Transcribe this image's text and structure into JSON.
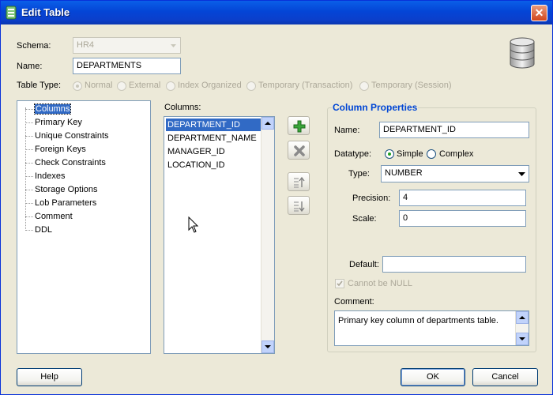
{
  "window": {
    "title": "Edit Table"
  },
  "schema": {
    "label": "Schema:",
    "value": "HR4"
  },
  "name": {
    "label": "Name:",
    "value": "DEPARTMENTS"
  },
  "table_type": {
    "label": "Table Type:",
    "options": [
      "Normal",
      "External",
      "Index Organized",
      "Temporary (Transaction)",
      "Temporary (Session)"
    ],
    "selected": "Normal"
  },
  "nav_tree": {
    "items": [
      "Columns",
      "Primary Key",
      "Unique Constraints",
      "Foreign Keys",
      "Check Constraints",
      "Indexes",
      "Storage Options",
      "Lob Parameters",
      "Comment",
      "DDL"
    ],
    "selected": "Columns"
  },
  "columns_list": {
    "label": "Columns:",
    "items": [
      "DEPARTMENT_ID",
      "DEPARTMENT_NAME",
      "MANAGER_ID",
      "LOCATION_ID"
    ],
    "selected": "DEPARTMENT_ID"
  },
  "column_properties": {
    "title": "Column Properties",
    "name_label": "Name:",
    "name_value": "DEPARTMENT_ID",
    "datatype_label": "Datatype:",
    "datatype_simple": "Simple",
    "datatype_complex": "Complex",
    "type_label": "Type:",
    "type_value": "NUMBER",
    "precision_label": "Precision:",
    "precision_value": "4",
    "scale_label": "Scale:",
    "scale_value": "0",
    "default_label": "Default:",
    "default_value": "",
    "not_null_label": "Cannot be NULL",
    "comment_label": "Comment:",
    "comment_value": "Primary key column of departments table."
  },
  "buttons": {
    "help": "Help",
    "ok": "OK",
    "cancel": "Cancel"
  },
  "icons": [
    "add-icon",
    "remove-icon",
    "move-up-icon",
    "move-down-icon",
    "database-icon"
  ],
  "colors": {
    "title_bar": "#0a5fe8",
    "selection": "#316ac5",
    "group_title": "#0046d5"
  }
}
